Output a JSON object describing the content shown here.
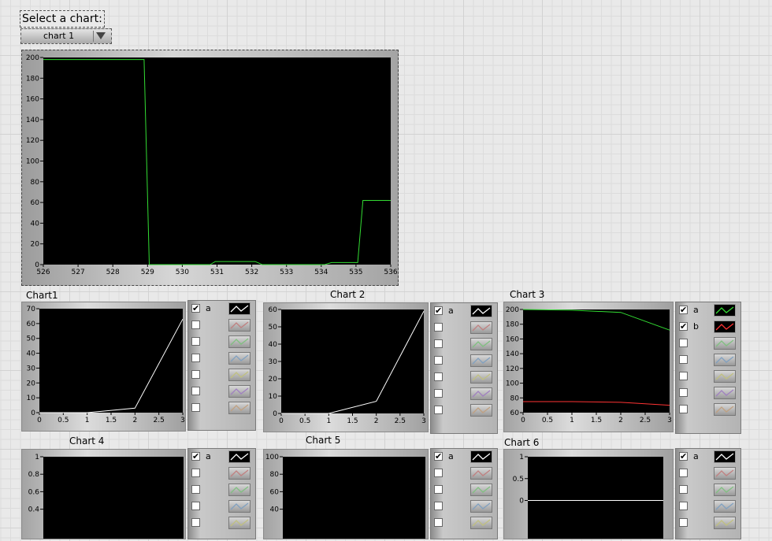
{
  "select_label": "Select a chart:",
  "selector": {
    "value": "chart 1"
  },
  "chart_data": [
    {
      "id": "main",
      "type": "line",
      "title": "",
      "xlim": [
        526,
        536
      ],
      "ylim": [
        0,
        200
      ],
      "x_ticks": [
        526,
        527,
        528,
        529,
        530,
        531,
        532,
        533,
        534,
        535,
        536
      ],
      "y_ticks": [
        0,
        20,
        40,
        60,
        80,
        100,
        120,
        140,
        160,
        180,
        200
      ],
      "series": [
        {
          "color": "#33dd33",
          "points": [
            [
              526,
              198
            ],
            [
              528.9,
              198
            ],
            [
              529.05,
              0
            ],
            [
              530.8,
              0
            ],
            [
              530.95,
              3
            ],
            [
              532.1,
              3
            ],
            [
              532.3,
              0
            ],
            [
              534.1,
              0
            ],
            [
              534.3,
              2
            ],
            [
              535.05,
              2
            ],
            [
              535.2,
              62
            ],
            [
              536,
              62
            ]
          ]
        }
      ]
    },
    {
      "id": "chart1",
      "type": "line",
      "title": "Chart1",
      "xlim": [
        0,
        3
      ],
      "ylim": [
        0,
        70
      ],
      "x_ticks": [
        "0",
        "0.5",
        "1",
        "1.5",
        "2",
        "2.5",
        "3"
      ],
      "y_ticks": [
        0,
        10,
        20,
        30,
        40,
        50,
        60,
        70
      ],
      "series": [
        {
          "name": "a",
          "color": "#ffffff",
          "points": [
            [
              0,
              0
            ],
            [
              1,
              0
            ],
            [
              2,
              3
            ],
            [
              3,
              63
            ]
          ]
        }
      ]
    },
    {
      "id": "chart2",
      "type": "line",
      "title": "Chart 2",
      "xlim": [
        0,
        3
      ],
      "ylim": [
        0,
        60
      ],
      "x_ticks": [
        "0",
        "0.5",
        "1",
        "1.5",
        "2",
        "2.5",
        "3"
      ],
      "y_ticks": [
        0,
        10,
        20,
        30,
        40,
        50,
        60
      ],
      "series": [
        {
          "name": "a",
          "color": "#ffffff",
          "points": [
            [
              0,
              0
            ],
            [
              1,
              0
            ],
            [
              2,
              7
            ],
            [
              3,
              59
            ]
          ]
        }
      ]
    },
    {
      "id": "chart3",
      "type": "line",
      "title": "Chart 3",
      "xlim": [
        0,
        3
      ],
      "ylim": [
        60,
        200
      ],
      "x_ticks": [
        "0",
        "0.5",
        "1",
        "1.5",
        "2",
        "2.5",
        "3"
      ],
      "y_ticks": [
        60,
        80,
        100,
        120,
        140,
        160,
        180,
        200
      ],
      "series": [
        {
          "name": "a",
          "color": "#33dd33",
          "points": [
            [
              0,
              200
            ],
            [
              1,
              199
            ],
            [
              2,
              196
            ],
            [
              3,
              172
            ]
          ]
        },
        {
          "name": "b",
          "color": "#ff3333",
          "points": [
            [
              0,
              75
            ],
            [
              1,
              75
            ],
            [
              2,
              74
            ],
            [
              3,
              70
            ]
          ]
        }
      ]
    },
    {
      "id": "chart4",
      "type": "line",
      "title": "Chart 4",
      "xlim": [
        0,
        3
      ],
      "ylim": [
        0,
        1
      ],
      "y_ticks": [
        "1",
        "0.8",
        "0.6",
        "0.4"
      ],
      "series": [
        {
          "name": "a",
          "color": "#ffffff",
          "points": []
        }
      ]
    },
    {
      "id": "chart5",
      "type": "line",
      "title": "Chart 5",
      "xlim": [
        0,
        3
      ],
      "ylim": [
        0,
        100
      ],
      "y_ticks": [
        "100",
        "80",
        "60",
        "40"
      ],
      "series": [
        {
          "name": "a",
          "color": "#ffffff",
          "points": []
        }
      ]
    },
    {
      "id": "chart6",
      "type": "line",
      "title": "Chart 6",
      "xlim": [
        0,
        3
      ],
      "ylim": [
        -1,
        1
      ],
      "y_ticks": [
        "1",
        "0.5",
        "0"
      ],
      "series": [
        {
          "name": "a",
          "color": "#ffffff",
          "points": [
            [
              0,
              0
            ],
            [
              3,
              0
            ]
          ]
        }
      ]
    }
  ],
  "legend_colors": [
    "#ffffff",
    "#c08080",
    "#80c080",
    "#80a0c0",
    "#c0c080",
    "#a080c0",
    "#c0a080",
    "#9090b0"
  ]
}
